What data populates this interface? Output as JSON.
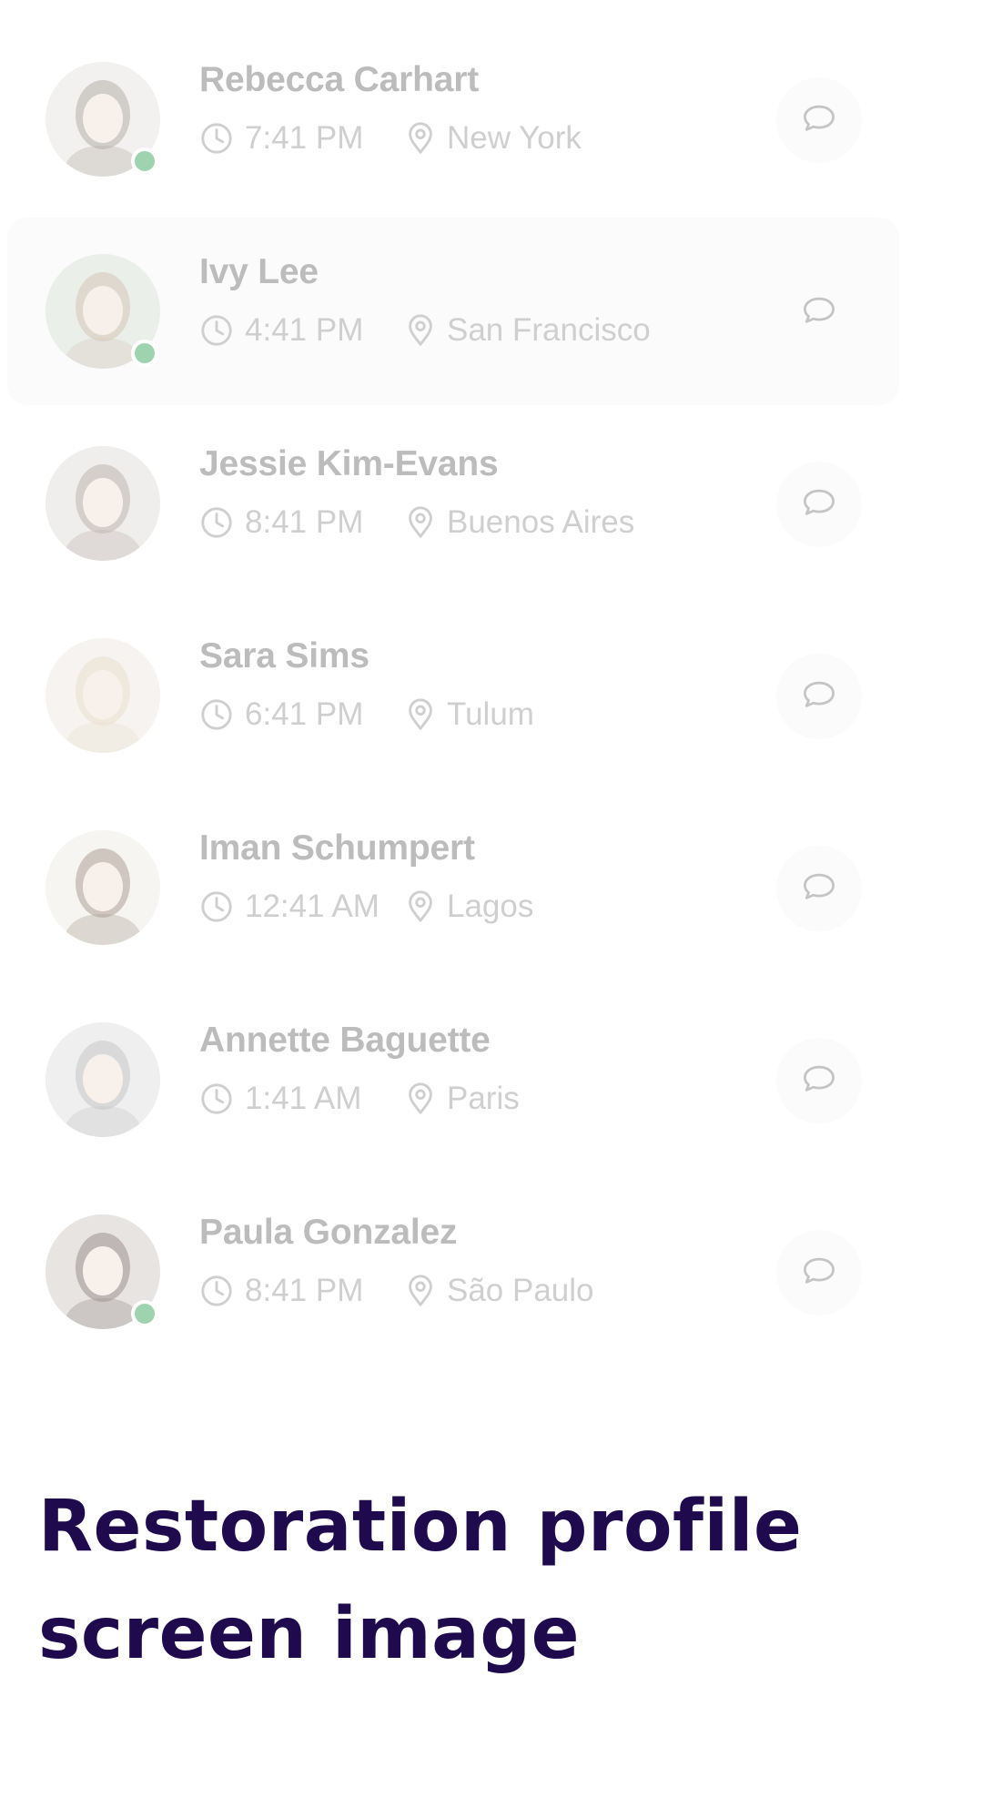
{
  "contacts": [
    {
      "name": "Rebecca Carhart",
      "time": "7:41 PM",
      "location": "New York",
      "online": true,
      "avatar_bg": "#e8e6e2",
      "avatar_fg": "#7a7064"
    },
    {
      "name": "Ivy Lee",
      "time": "4:41 PM",
      "location": "San Francisco",
      "online": true,
      "avatar_bg": "#dfe6da",
      "avatar_fg": "#b59a86"
    },
    {
      "name": "Jessie Kim-Evans",
      "time": "8:41 PM",
      "location": "Buenos Aires",
      "online": false,
      "avatar_bg": "#e3e1df",
      "avatar_fg": "#8e7b70"
    },
    {
      "name": "Sara Sims",
      "time": "6:41 PM",
      "location": "Tulum",
      "online": false,
      "avatar_bg": "#efeae4",
      "avatar_fg": "#d9c8a8"
    },
    {
      "name": "Iman Schumpert",
      "time": "12:41 AM",
      "location": "Lagos",
      "online": false,
      "avatar_bg": "#f2eee6",
      "avatar_fg": "#6e5442"
    },
    {
      "name": "Annette Baguette",
      "time": "1:41 AM",
      "location": "Paris",
      "online": false,
      "avatar_bg": "#e2e2e2",
      "avatar_fg": "#9a9a9a"
    },
    {
      "name": "Paula Gonzalez",
      "time": "8:41 PM",
      "location": "São Paulo",
      "online": true,
      "avatar_bg": "#d4cfcc",
      "avatar_fg": "#4a3a34"
    }
  ],
  "highlighted_index": 1,
  "caption": {
    "line1": "Restoration profile",
    "line2": "screen image"
  },
  "icons": {
    "time": "clock-icon",
    "location": "map-pin-icon",
    "message": "chat-bubble-icon"
  },
  "colors": {
    "caption": "#1f0a4d",
    "online": "#9fd3b0",
    "name": "#bcbcbc",
    "meta": "#cfcfcf"
  }
}
